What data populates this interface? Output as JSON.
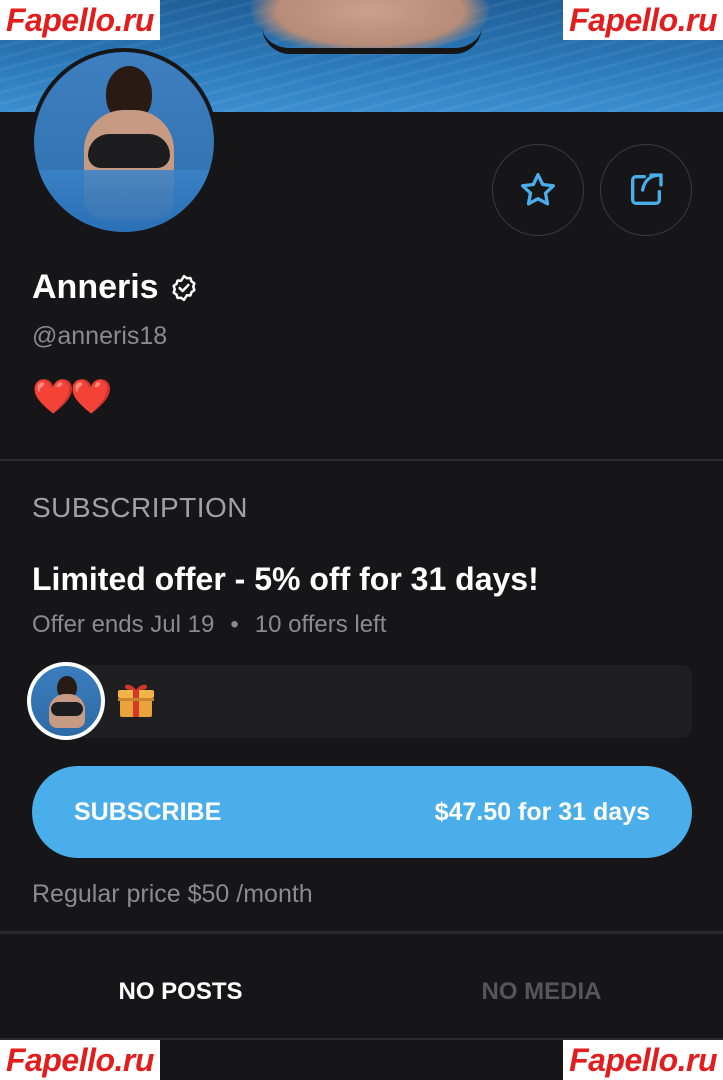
{
  "watermark": {
    "text": "Fapello.ru"
  },
  "profile": {
    "name": "Anneris",
    "handle": "@anneris18",
    "bio": "❤️❤️"
  },
  "icons": {
    "verified": "verified-badge-icon",
    "favorite": "star-icon",
    "share": "share-icon",
    "gift": "gift-icon"
  },
  "subscription": {
    "heading": "SUBSCRIPTION",
    "offer_title": "Limited offer - 5% off for 31 days!",
    "offer_ends": "Offer ends Jul 19",
    "offers_left": "10 offers left",
    "meta_separator": "•",
    "subscribe_label": "SUBSCRIBE",
    "subscribe_price": "$47.50 for 31 days",
    "regular_price": "Regular price $50 /month"
  },
  "tabs": [
    {
      "label": "NO POSTS",
      "active": true
    },
    {
      "label": "NO MEDIA",
      "active": false
    }
  ],
  "colors": {
    "background": "#161618",
    "accent": "#4aaeea",
    "watermark_red": "#e11d1d",
    "muted_text": "#8a8a90"
  }
}
